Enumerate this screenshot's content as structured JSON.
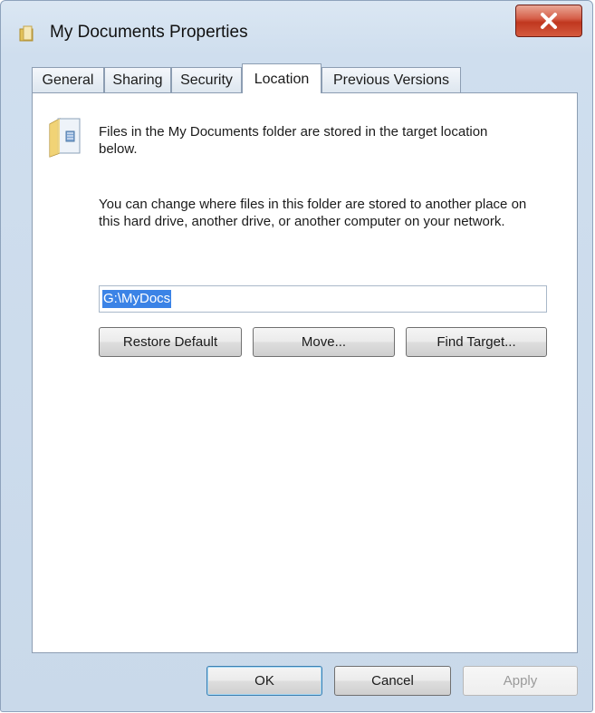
{
  "window": {
    "title": "My Documents Properties",
    "accent_close": "#c0371f"
  },
  "tabs": [
    {
      "label": "General"
    },
    {
      "label": "Sharing"
    },
    {
      "label": "Security"
    },
    {
      "label": "Location",
      "active": true
    },
    {
      "label": "Previous Versions"
    }
  ],
  "location": {
    "description_1": "Files in the My Documents folder are stored in the target location below.",
    "description_2": "You can change where files in this folder are stored to another place on this hard drive, another drive, or another computer on your network.",
    "path_value": "G:\\MyDocs",
    "restore_default_label": "Restore Default",
    "move_label": "Move...",
    "find_target_label": "Find Target..."
  },
  "footer": {
    "ok_label": "OK",
    "cancel_label": "Cancel",
    "apply_label": "Apply"
  },
  "icons": {
    "title": "folder-icon",
    "close": "close-icon",
    "location": "folder-document-icon"
  }
}
